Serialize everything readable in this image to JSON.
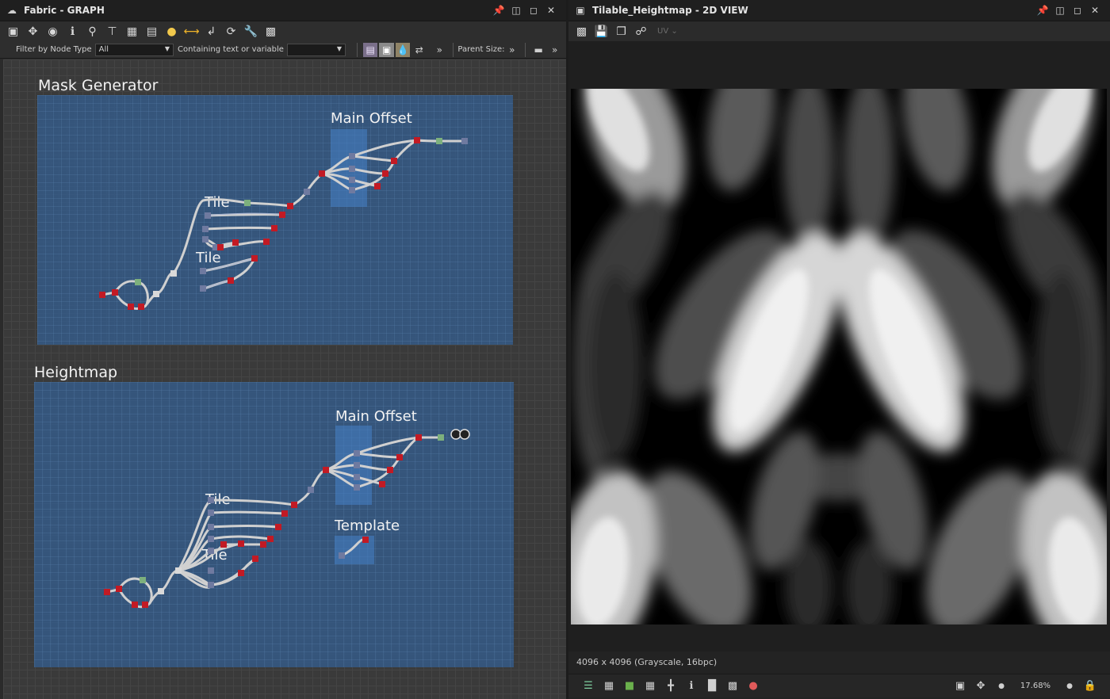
{
  "graph_panel": {
    "title": "Fabric - GRAPH",
    "filter": {
      "node_type_label": "Filter by Node Type",
      "node_type_value": "All",
      "text_label": "Containing text or variable",
      "text_value": "",
      "parent_size_label": "Parent Size:"
    },
    "frames": {
      "mask_generator": {
        "title": "Mask Generator",
        "main_offset": "Main Offset",
        "tile_a": "Tile",
        "tile_b": "Tile"
      },
      "heightmap": {
        "title": "Heightmap",
        "main_offset": "Main Offset",
        "template": "Template",
        "tile_a": "Tile",
        "tile_b": "Tile"
      }
    },
    "colors": {
      "frame": "#355b87",
      "subframe": "#4682c8",
      "node_red": "#c21a24",
      "node_slate": "#6f7aa0",
      "node_green": "#7db07d",
      "wire": "#cfcfcf"
    }
  },
  "view_panel": {
    "title": "Tilable_Heightmap - 2D VIEW",
    "uv_label": "UV",
    "resolution_text": "4096 x 4096 (Grayscale, 16bpc)",
    "zoom": "17.68%"
  }
}
